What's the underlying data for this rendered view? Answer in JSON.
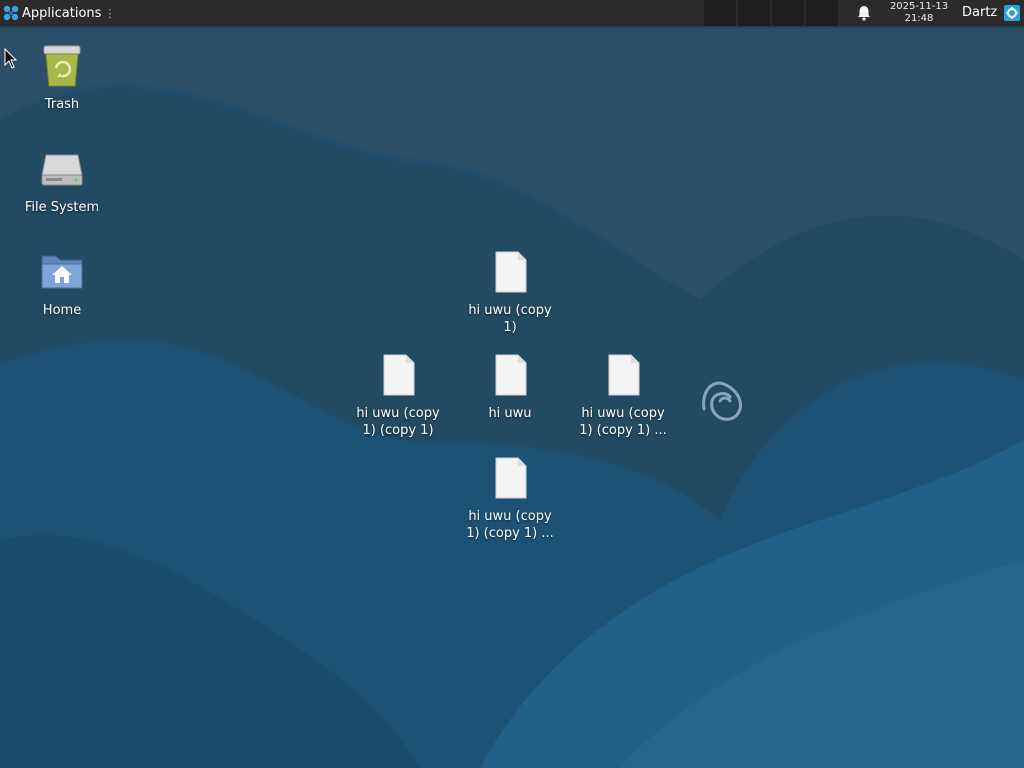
{
  "panel": {
    "applications_label": "Applications",
    "clock_date": "2025-11-13",
    "clock_time": "21:48",
    "user_name": "Dartz"
  },
  "desktop": {
    "system_icons": [
      {
        "label": "Trash",
        "icon": "trash-icon"
      },
      {
        "label": "File System",
        "icon": "drive-icon"
      },
      {
        "label": "Home",
        "icon": "home-folder-icon"
      }
    ],
    "files": [
      {
        "label": "hi uwu (copy\n1)",
        "icon": "document-icon"
      },
      {
        "label": "hi uwu (copy\n1) (copy 1)",
        "icon": "document-icon"
      },
      {
        "label": "hi uwu",
        "icon": "document-icon"
      },
      {
        "label": "hi uwu (copy\n1) (copy 1) ...",
        "icon": "document-icon"
      },
      {
        "label": "hi uwu (copy\n1) (copy 1) ...",
        "icon": "document-icon"
      }
    ]
  },
  "colors": {
    "panel_bg": "#2b2b2b",
    "wallpaper_base": "#20506f",
    "accent": "#2aa0e0"
  }
}
